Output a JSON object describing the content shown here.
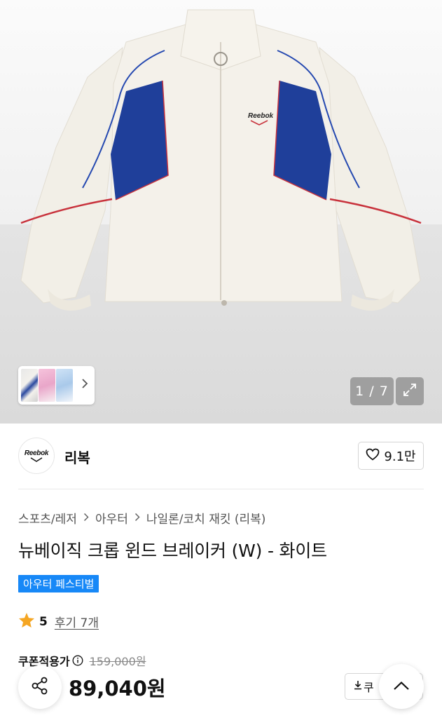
{
  "gallery": {
    "pager_text": "1 / 7",
    "current_index": 1,
    "total": 7,
    "thumbnail_count": 3,
    "logo_text": "Reebok"
  },
  "brand": {
    "name": "리복",
    "logo_text": "Reebok",
    "like_count": "9.1만"
  },
  "breadcrumb": {
    "items": [
      "스포츠/레저",
      "아우터",
      "나일론/코치 재킷 (리복)"
    ]
  },
  "product": {
    "title": "뉴베이직 크롭 윈드 브레이커 (W) - 화이트",
    "badge": "아우터 페스티벌"
  },
  "rating": {
    "score": "5",
    "review_link": "후기 7개"
  },
  "price": {
    "coupon_label": "쿠폰적용가",
    "original": "159,000원",
    "sale": "89,040원",
    "coupon_button": "쿠"
  },
  "colors": {
    "accent_blue": "#1788f7",
    "star": "#f5a623",
    "jacket_blue": "#1f3f9a",
    "jacket_red": "#c8323c"
  },
  "icons": [
    "chevron-right-icon",
    "expand-icon",
    "heart-icon",
    "star-icon",
    "info-icon",
    "share-icon",
    "download-icon",
    "chevron-up-icon"
  ]
}
